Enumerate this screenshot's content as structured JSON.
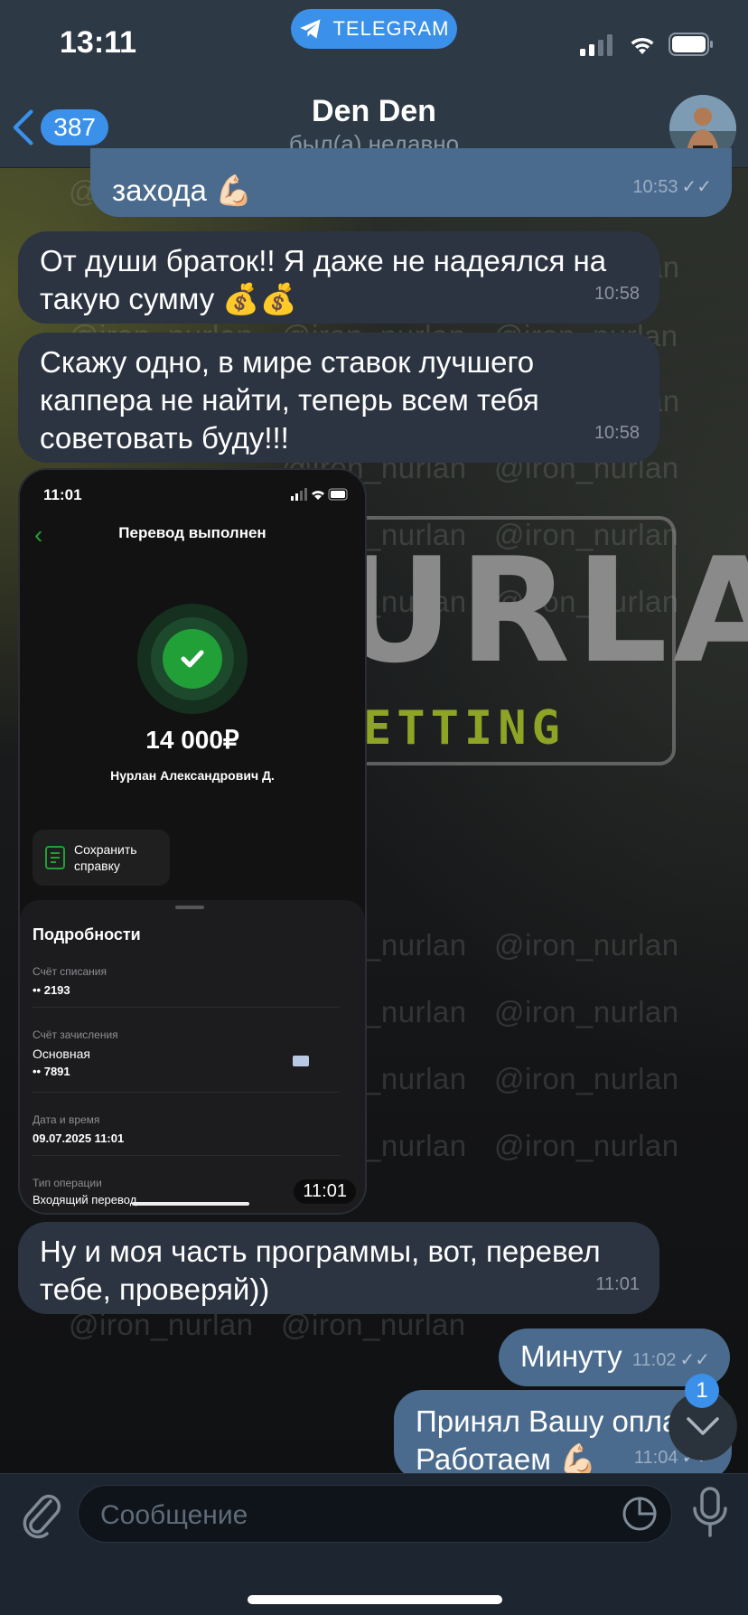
{
  "status_bar": {
    "time": "13:11",
    "telegram_label": "TELEGRAM"
  },
  "header": {
    "back_count": "387",
    "title": "Den Den",
    "subtitle": "был(а) недавно"
  },
  "watermark": {
    "text": "@iron_nurlan",
    "logo_main": "URLAN",
    "logo_sub": "ETTING"
  },
  "messages": [
    {
      "text": "захода 💪🏻",
      "time": "10:53"
    },
    {
      "text": "От души браток!! Я даже не надеялся на такую сумму 💰💰",
      "time": "10:58"
    },
    {
      "text": "Скажу одно, в мире ставок лучшего каппера не найти, теперь всем тебя советовать буду!!!",
      "time": "10:58"
    },
    {
      "text": "Ну и моя часть программы, вот, перевел тебе, проверяй))",
      "time": "11:01"
    },
    {
      "text": "Минуту",
      "time": "11:02"
    },
    {
      "text": "Принял Вашу опла",
      "text2": "Работаем 💪🏻",
      "time": "11:04"
    }
  ],
  "transfer": {
    "status_time": "11:01",
    "title": "Перевод выполнен",
    "amount": "14 000₽",
    "payee": "Нурлан Александрович Д.",
    "save_label_1": "Сохранить",
    "save_label_2": "справку",
    "details_title": "Подробности",
    "debit_label": "Счёт списания",
    "debit_value": "•• 2193",
    "credit_label": "Счёт зачисления",
    "credit_name": "Основная",
    "credit_value": "•• 7891",
    "date_label": "Дата и время",
    "date_value": "09.07.2025 11:01",
    "type_label": "Тип операции",
    "type_value": "Входящий перевод",
    "message_time": "11:01"
  },
  "scroll_badge": "1",
  "composer": {
    "placeholder": "Сообщение"
  },
  "colors": {
    "accent": "#3b90e9",
    "incoming": "#2c3442",
    "outgoing": "#4a6b8e",
    "success": "#21a038"
  }
}
